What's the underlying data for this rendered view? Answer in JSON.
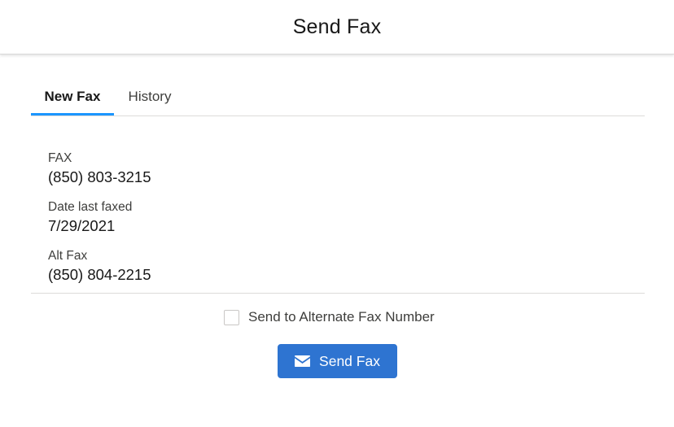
{
  "header": {
    "title": "Send Fax"
  },
  "tabs": [
    {
      "label": "New Fax",
      "active": true
    },
    {
      "label": "History",
      "active": false
    }
  ],
  "fields": {
    "fax": {
      "label": "FAX",
      "value": "(850) 803-3215"
    },
    "date_last_faxed": {
      "label": "Date last faxed",
      "value": "7/29/2021"
    },
    "alt_fax": {
      "label": "Alt Fax",
      "value": "(850) 804-2215"
    }
  },
  "alternate_checkbox": {
    "label": "Send to Alternate Fax Number",
    "checked": false
  },
  "send_button": {
    "label": "Send Fax",
    "icon": "envelope-icon"
  },
  "colors": {
    "accent": "#1b96ff",
    "button": "#2e74d1"
  }
}
